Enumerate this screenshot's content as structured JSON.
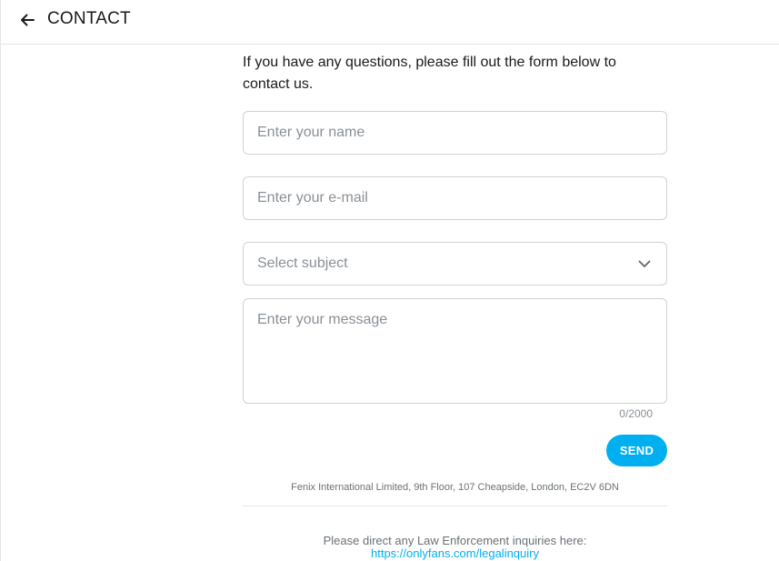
{
  "header": {
    "title": "CONTACT",
    "back_icon": "arrow-left-icon"
  },
  "intro": {
    "text": "If you have any questions, please fill out the form below to contact us."
  },
  "form": {
    "name_placeholder": "Enter your name",
    "email_placeholder": "Enter your e-mail",
    "subject_placeholder": "Select subject",
    "subject_icon": "chevron-down-icon",
    "message_placeholder": "Enter your message",
    "counter": "0/2000",
    "send_label": "SEND"
  },
  "footer": {
    "company": "Fenix International Limited, 9th Floor, 107 Cheapside, London, EC2V 6DN",
    "law_text": "Please direct any Law Enforcement inquiries here:",
    "law_link": "https://onlyfans.com/legalinquiry"
  },
  "colors": {
    "accent": "#00aff0",
    "border": "#cfd3d6",
    "muted_text": "#8a9096"
  }
}
